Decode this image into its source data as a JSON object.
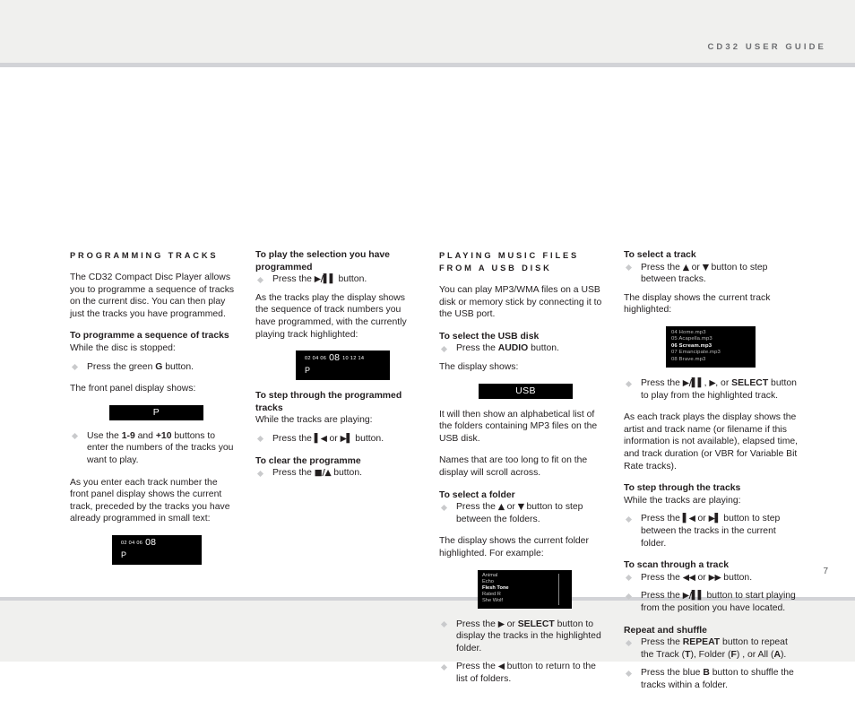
{
  "header": {
    "running_head": "CD32 USER GUIDE"
  },
  "footer": {
    "page_number": "7"
  },
  "column_1": {
    "section_title": "PROGRAMMING TRACKS",
    "intro": "The CD32 Compact Disc Player allows you to programme a sequence of tracks on the current disc. You can then play just the tracks you have programmed.",
    "heading_programme": "To programme a sequence of tracks",
    "lead_programme": "While the disc is stopped:",
    "bullet_green": "Press the green G button.",
    "text_front_panel": "The front panel display shows:",
    "lcd_p": "P",
    "bullet_numbers": "Use the 1-9 and +10 buttons to enter the numbers of the tracks you want to play.",
    "text_as_you_enter": "As you enter each track number the front panel display shows the current track, preceded by the tracks you have already programmed in small text:",
    "lcd_programmed_small": "02 04 06",
    "lcd_programmed_big": "08",
    "lcd_programmed_mark": "P"
  },
  "column_2": {
    "heading_play": "To play the selection you have programmed",
    "bullet_play": "Press the ▶/▐▐ button.",
    "text_as_tracks_play": "As the tracks play the display shows the sequence of track numbers you have programmed, with the currently playing track highlighted:",
    "lcd_before": "02 04 06",
    "lcd_current": "08",
    "lcd_after": "10 12 14",
    "lcd_mark": "P",
    "heading_step": "To step through the programmed tracks",
    "lead_step": "While the tracks are playing:",
    "bullet_step": "Press the ▌◀ or ▶▐ button.",
    "heading_clear": "To clear the programme",
    "bullet_clear": "Press the ■/▲ button."
  },
  "column_3": {
    "section_title": "PLAYING MUSIC FILES FROM A USB DISK",
    "intro": "You can play MP3/WMA files on a USB disk or memory stick by connecting it to the USB port.",
    "heading_select_usb": "To select the USB disk",
    "bullet_audio": "Press the AUDIO button.",
    "text_display_shows": "The display shows:",
    "lcd_usb": "USB",
    "text_alphabetical": "It will then show an alphabetical list of the folders containing MP3 files on the USB disk.",
    "text_scroll": "Names that are too long to fit on the display will scroll across.",
    "heading_select_folder": "To select a folder",
    "bullet_updown": "Press the ▲ or ▼ button to step between the folders.",
    "text_current_folder": "The display shows the current folder highlighted. For example:",
    "folder_list": [
      {
        "name": "Animal",
        "selected": false
      },
      {
        "name": "Echo",
        "selected": false
      },
      {
        "name": "Flesh Tone",
        "selected": true
      },
      {
        "name": "Rated R",
        "selected": false
      },
      {
        "name": "She Wolf",
        "selected": false
      }
    ],
    "bullet_select_folder": "Press the ▶ or SELECT button to display the tracks in the highlighted folder.",
    "bullet_back": "Press the ◀ button to return to the list of folders."
  },
  "column_4": {
    "heading_select_track": "To select a track",
    "bullet_updown": "Press the ▲ or ▼ button to step between tracks.",
    "text_current_track": "The display shows the current track highlighted:",
    "track_list": [
      {
        "name": "04 Home.mp3",
        "selected": false
      },
      {
        "name": "05 Acapella.mp3",
        "selected": false
      },
      {
        "name": "06 Scream.mp3",
        "selected": true
      },
      {
        "name": "07 Emancipate.mp3",
        "selected": false
      },
      {
        "name": "08 Brave.mp3",
        "selected": false
      }
    ],
    "bullet_play_highlighted": "Press the ▶/▐▐, ▶, or SELECT button to play from the highlighted track.",
    "text_as_each_track": "As each track plays the display shows the artist and track name (or filename if this information is not available), elapsed time, and track duration (or VBR for Variable Bit Rate tracks).",
    "heading_step_tracks": "To step through the tracks",
    "lead_step_tracks": "While the tracks are playing:",
    "bullet_step_tracks": "Press the ▌◀ or ▶▐ button to step between the tracks in the current folder.",
    "heading_scan": "To scan through a track",
    "bullet_scan": "Press the ◀◀ or ▶▶ button.",
    "bullet_scan_play": "Press the ▶/▐▐ button to start playing from the position you have located.",
    "heading_repeat": "Repeat and shuffle",
    "bullet_repeat": "Press the REPEAT button to repeat the Track (T), Folder (F) , or All (A).",
    "bullet_shuffle": "Press the blue B button to shuffle the tracks within a folder."
  }
}
